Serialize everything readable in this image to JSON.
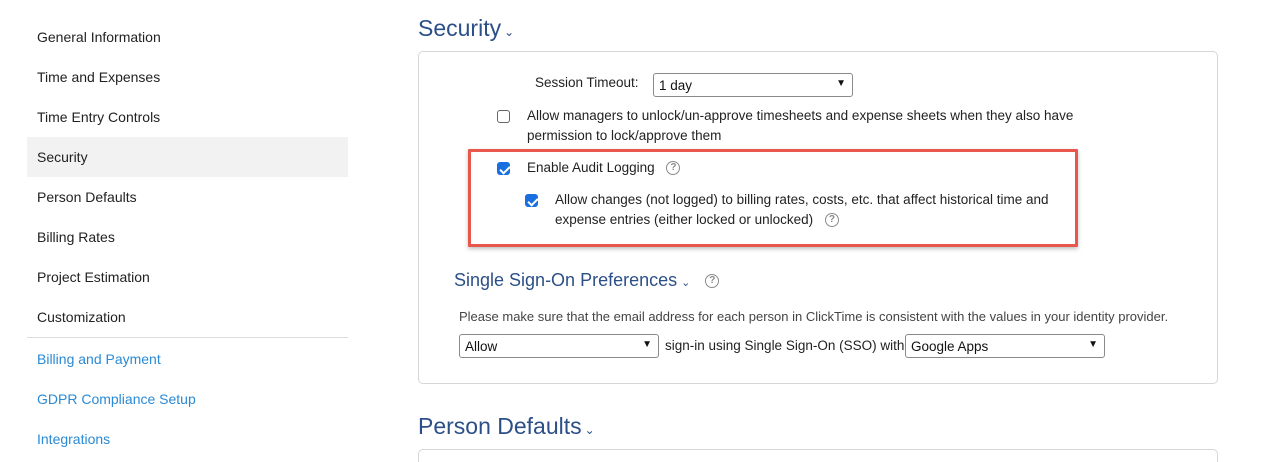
{
  "sidebar": {
    "items": [
      {
        "label": "General Information"
      },
      {
        "label": "Time and Expenses"
      },
      {
        "label": "Time Entry Controls"
      },
      {
        "label": "Security"
      },
      {
        "label": "Person Defaults"
      },
      {
        "label": "Billing Rates"
      },
      {
        "label": "Project Estimation"
      },
      {
        "label": "Customization"
      }
    ],
    "active": "Security",
    "links": [
      {
        "label": "Billing and Payment"
      },
      {
        "label": "GDPR Compliance Setup"
      },
      {
        "label": "Integrations"
      }
    ]
  },
  "security": {
    "title": "Security",
    "session_timeout_label": "Session Timeout:",
    "session_timeout_value": "1 day",
    "allow_managers_unlock_line1": "Allow managers to unlock/un-approve timesheets and expense sheets when they also have",
    "allow_managers_unlock_line2": "permission to lock/approve them",
    "allow_managers_unlock_checked": false,
    "audit_logging_label": "Enable Audit Logging",
    "audit_logging_checked": true,
    "allow_changes_line1": "Allow changes (not logged) to billing rates, costs, etc. that affect historical time and",
    "allow_changes_line2": "expense entries (either locked or unlocked)",
    "allow_changes_checked": true,
    "help_glyph": "?"
  },
  "sso": {
    "title": "Single Sign-On Preferences",
    "note": "Please make sure that the email address for each person in ClickTime is consistent with the values in your identity provider.",
    "mode_value": "Allow",
    "middle_text": "sign-in using Single Sign-On (SSO) with",
    "provider_value": "Google Apps"
  },
  "person_defaults": {
    "title": "Person Defaults"
  },
  "colors": {
    "accent_title": "#2c4f88",
    "link": "#2a8ad4",
    "checkbox": "#1a6fe0",
    "highlight_border": "#e8574b"
  }
}
